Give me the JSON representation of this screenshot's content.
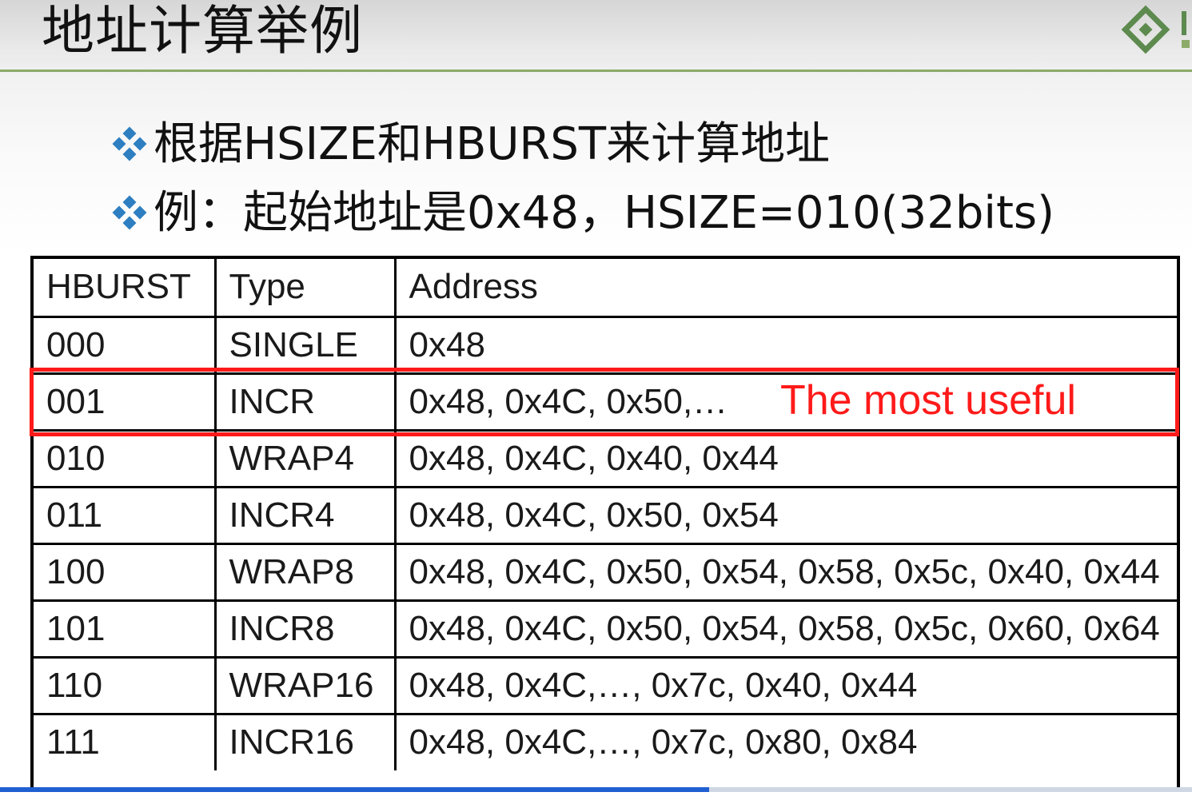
{
  "title": "地址计算举例",
  "bullets": [
    "根据HSIZE和HBURST来计算地址",
    "例：起始地址是0x48，HSIZE=010(32bits)"
  ],
  "table": {
    "headers": [
      "HBURST",
      "Type",
      "Address"
    ],
    "rows": [
      [
        "000",
        "SINGLE",
        "0x48"
      ],
      [
        "001",
        "INCR",
        "0x48, 0x4C, 0x50,…"
      ],
      [
        "010",
        "WRAP4",
        "0x48, 0x4C, 0x40, 0x44"
      ],
      [
        "011",
        "INCR4",
        "0x48, 0x4C, 0x50, 0x54"
      ],
      [
        "100",
        "WRAP8",
        "0x48, 0x4C, 0x50, 0x54, 0x58, 0x5c, 0x40, 0x44"
      ],
      [
        "101",
        "INCR8",
        "0x48, 0x4C, 0x50, 0x54, 0x58, 0x5c, 0x60, 0x64"
      ],
      [
        "110",
        "WRAP16",
        "0x48, 0x4C,…, 0x7c, 0x40, 0x44"
      ],
      [
        "111",
        "INCR16",
        "0x48, 0x4C,…, 0x7c, 0x80, 0x84"
      ]
    ]
  },
  "annotation": "The most useful",
  "colors": {
    "title_rule": "#8caa6a",
    "bullet_icon": "#2e7fc1",
    "highlight": "#ff1a1a",
    "logo": "#5d8a4e"
  },
  "icons": {
    "bullet": "four-diamond-bullet-icon",
    "logo": "company-logo"
  }
}
